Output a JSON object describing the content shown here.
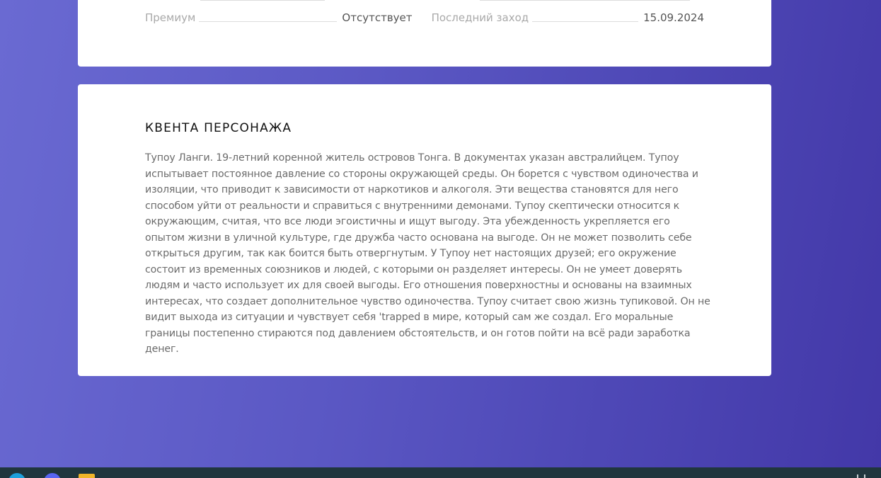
{
  "profile_stats": {
    "premium_label": "Премиум",
    "premium_value": "Отсутствует",
    "last_login_label": "Последний заход",
    "last_login_value": "15.09.2024"
  },
  "lore": {
    "title": "КВЕНТА ПЕРСОНАЖА",
    "text": "Тупоу Ланги. 19-летний коренной житель островов Тонга. В документах указан австралийцем. Тупоу испытывает постоянное давление со стороны окружающей среды. Он борется с чувством одиночества и изоляции, что приводит к зависимости от наркотиков и алкоголя. Эти вещества становятся для него способом уйти от реальности и справиться с внутренними демонами. Тупоу скептически относится к окружающим, считая, что все люди эгоистичны и ищут выгоду. Эта убежденность укрепляется его опытом жизни в уличной культуре, где дружба часто основана на выгоде. Он не может позволить себе открыться другим, так как боится быть отвергнутым. У Тупоу нет настоящих друзей; его окружение состоит из временных союзников и людей, с которыми он разделяет интересы. Он не умеет доверять людям и часто использует их для своей выгоды. Его отношения поверхностны и основаны на взаимных интересах, что создает дополнительное чувство одиночества. Тупоу считает свою жизнь тупиковой. Он не видит выхода из ситуации и чувствует себя 'trapped в мире, который сам же создал. Его моральные границы постепенно стираются под давлением обстоятельств, и он готов пойти на всё ради заработка денег."
  },
  "taskbar": {
    "icons": [
      "browser-icon",
      "discord-icon",
      "folder-icon"
    ],
    "colors": {
      "browser": "#1ea0dc",
      "discord": "#5865f2",
      "folder": "#f0b429",
      "bar": "#20363e"
    }
  },
  "theme": {
    "background_gradient": [
      "#6a6ad2",
      "#4338a8"
    ],
    "card": "#ffffff",
    "label_color": "#a9a9a9",
    "value_color": "#555555",
    "title_color": "#111111",
    "text_color": "#6b6b6b"
  }
}
